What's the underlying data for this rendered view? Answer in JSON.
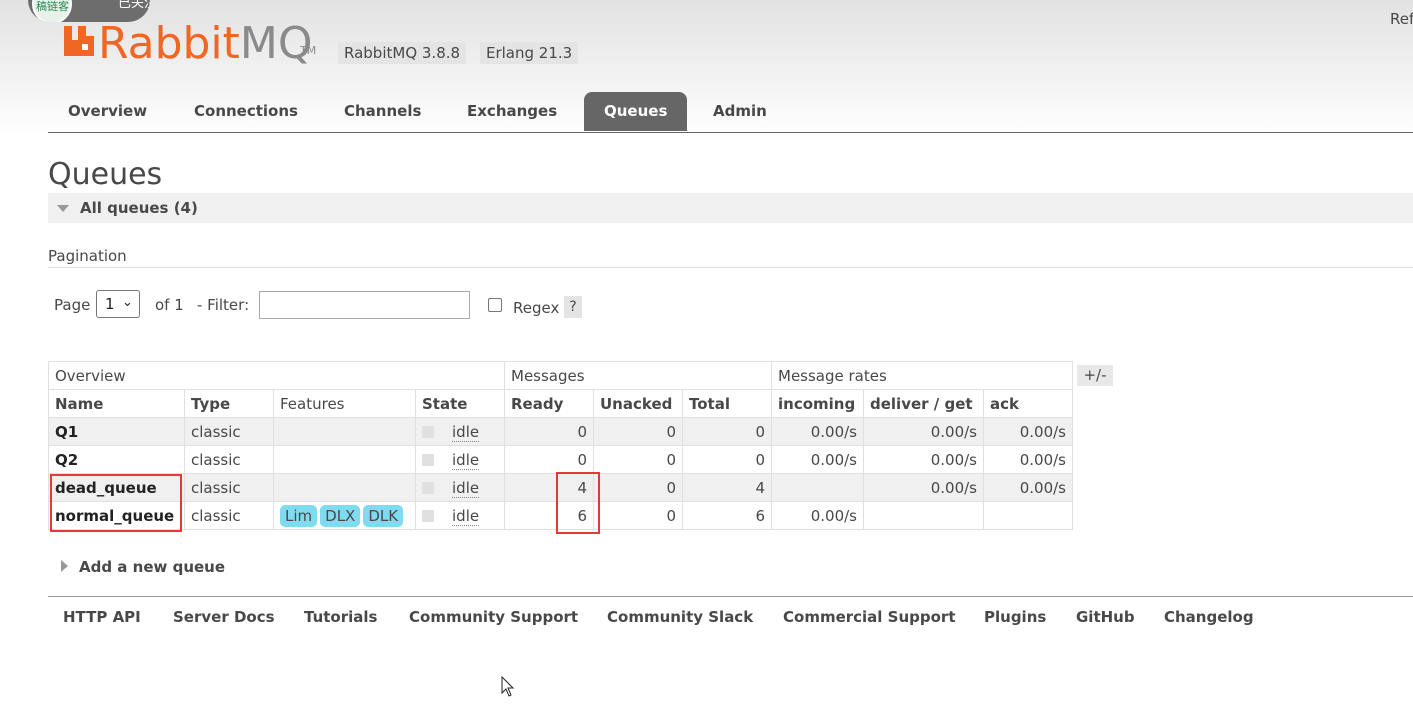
{
  "overlay": {
    "badge_text": "稿链客",
    "button_text": "已关注"
  },
  "brand": {
    "rabbit": "Rabbit",
    "mq": "MQ",
    "tm": "TM",
    "logo_icon": "rabbitmq-logo-icon"
  },
  "versions": {
    "rabbitmq": "RabbitMQ 3.8.8",
    "erlang": "Erlang 21.3"
  },
  "refresh_text": "Ref",
  "nav": {
    "tabs": [
      {
        "label": "Overview"
      },
      {
        "label": "Connections"
      },
      {
        "label": "Channels"
      },
      {
        "label": "Exchanges"
      },
      {
        "label": "Queues",
        "active": true
      },
      {
        "label": "Admin"
      }
    ]
  },
  "page_title": "Queues",
  "all_queues": {
    "label": "All queues (4)",
    "icon": "triangle-down-icon"
  },
  "pagination": {
    "title": "Pagination",
    "page_label": "Page",
    "page_value": "1",
    "of_label": "of 1",
    "filter_label": "- Filter:",
    "filter_value": "",
    "regex_label": "Regex",
    "regex_checked": false,
    "help": "?"
  },
  "table": {
    "groups": {
      "overview": "Overview",
      "messages": "Messages",
      "rates": "Message rates"
    },
    "columns": {
      "name": "Name",
      "type": "Type",
      "features": "Features",
      "state": "State",
      "ready": "Ready",
      "unacked": "Unacked",
      "total": "Total",
      "incoming": "incoming",
      "deliver_get": "deliver / get",
      "ack": "ack"
    },
    "toggle": "+/-",
    "rows": [
      {
        "name": "Q1",
        "type": "classic",
        "features": [],
        "state": "idle",
        "ready": "0",
        "unacked": "0",
        "total": "0",
        "incoming": "0.00/s",
        "deliver_get": "0.00/s",
        "ack": "0.00/s"
      },
      {
        "name": "Q2",
        "type": "classic",
        "features": [],
        "state": "idle",
        "ready": "0",
        "unacked": "0",
        "total": "0",
        "incoming": "0.00/s",
        "deliver_get": "0.00/s",
        "ack": "0.00/s"
      },
      {
        "name": "dead_queue",
        "type": "classic",
        "features": [],
        "state": "idle",
        "ready": "4",
        "unacked": "0",
        "total": "4",
        "incoming": "",
        "deliver_get": "0.00/s",
        "ack": "0.00/s"
      },
      {
        "name": "normal_queue",
        "type": "classic",
        "features": [
          "Lim",
          "DLX",
          "DLK"
        ],
        "state": "idle",
        "ready": "6",
        "unacked": "0",
        "total": "6",
        "incoming": "0.00/s",
        "deliver_get": "",
        "ack": ""
      }
    ]
  },
  "add_queue": {
    "label": "Add a new queue",
    "icon": "triangle-right-icon"
  },
  "footer": {
    "links": [
      "HTTP API",
      "Server Docs",
      "Tutorials",
      "Community Support",
      "Community Slack",
      "Commercial Support",
      "Plugins",
      "GitHub",
      "Changelog"
    ]
  },
  "highlight_color": "#e53935",
  "accent_color": "#f06623"
}
